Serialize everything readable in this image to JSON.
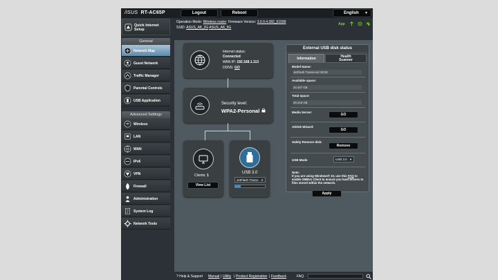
{
  "header": {
    "brand": "/ISUS",
    "model": "RT-AC65P",
    "logout_label": "Logout",
    "reboot_label": "Reboot",
    "language": "English"
  },
  "infobar": {
    "op_mode_label": "Operation Mode:",
    "op_mode_value": "Wireless router",
    "fw_label": "Firmware Version:",
    "fw_value": "3.0.0.4.382_51599",
    "ssid_label": "SSID:",
    "ssid_1": "ASUS_A8_2G",
    "ssid_2": "ASUS_A8_5G",
    "app_label": "App"
  },
  "sidebar": {
    "qis_label": "Quick Internet Setup",
    "general_label": "General",
    "general_items": [
      {
        "label": "Network Map",
        "icon": "network-map-icon"
      },
      {
        "label": "Guest Network",
        "icon": "guest-network-icon"
      },
      {
        "label": "Traffic Manager",
        "icon": "traffic-manager-icon"
      },
      {
        "label": "Parental Controls",
        "icon": "parental-controls-icon"
      },
      {
        "label": "USB Application",
        "icon": "usb-application-icon"
      }
    ],
    "advanced_label": "Advanced Settings",
    "advanced_items": [
      {
        "label": "Wireless",
        "icon": "wireless-icon"
      },
      {
        "label": "LAN",
        "icon": "lan-icon"
      },
      {
        "label": "WAN",
        "icon": "wan-icon"
      },
      {
        "label": "IPv6",
        "icon": "ipv6-icon"
      },
      {
        "label": "VPN",
        "icon": "vpn-icon"
      },
      {
        "label": "Firewall",
        "icon": "firewall-icon"
      },
      {
        "label": "Administration",
        "icon": "administration-icon"
      },
      {
        "label": "System Log",
        "icon": "system-log-icon"
      },
      {
        "label": "Network Tools",
        "icon": "network-tools-icon"
      }
    ]
  },
  "map": {
    "internet_status_label": "Internet status:",
    "internet_status_value": "Connected",
    "wan_ip_label": "WAN IP:",
    "wan_ip_value": "192.168.1.113",
    "ddns_label": "DDNS:",
    "ddns_value": "GO",
    "security_label": "Security level:",
    "security_value": "WPA2-Personal",
    "clients_label": "Clients:",
    "clients_value": "1",
    "view_list_label": "View List",
    "usb_label": "USB 3.0",
    "usb_device": "JetFlash Transc",
    "usb_usage_fraction": 0.18
  },
  "usb_panel": {
    "title": "External USB disk status",
    "tab_info": "Information",
    "tab_health": "Health Scanner",
    "model_name_label": "Model Name:",
    "model_name_value": "JetFlash Transcend 32GB",
    "available_label": "Available space:",
    "available_value": "24.407 GB",
    "total_label": "Total space:",
    "total_value": "29.419 GB",
    "media_server_label": "Media Server:",
    "media_server_btn": "GO",
    "aidisk_label": "AiDisk Wizard:",
    "aidisk_btn": "GO",
    "safe_remove_label": "Safely Remove disk:",
    "remove_btn": "Remove",
    "usb_mode_label": "USB Mode",
    "usb_mode_value": "USB 3.0",
    "note_label": "Note:",
    "note_text_1": "If you are using Windows® 10, use this ",
    "note_link": "FAQ",
    "note_text_2": " to enable SMBv1 Client to ensure you have access to files stored within the network.",
    "apply_btn": "Apply"
  },
  "footer": {
    "help": "Help & Support",
    "manual": "Manual",
    "utility": "Utility",
    "product_reg": "Product Registration",
    "feedback": "Feedback",
    "faq": "FAQ"
  }
}
